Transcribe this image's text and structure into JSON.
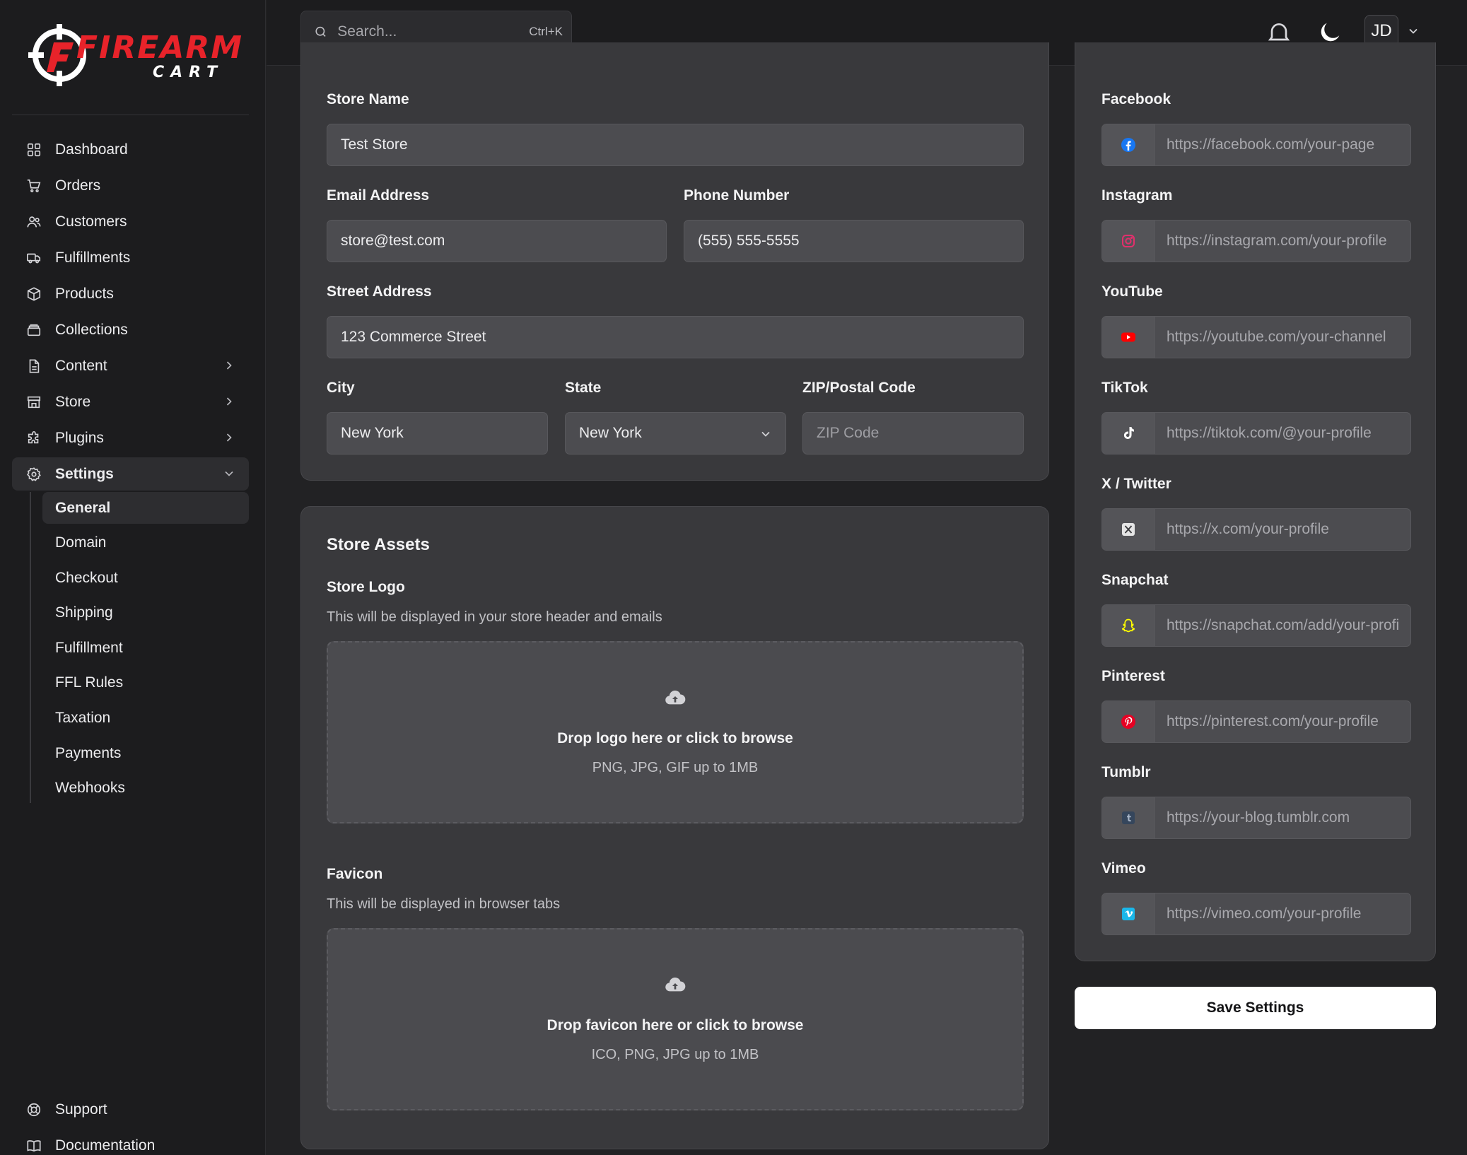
{
  "brand": {
    "name_top": "FIREARM",
    "name_bottom": "CART",
    "accent": "#e8232a"
  },
  "sidebar": {
    "items": [
      {
        "label": "Dashboard",
        "icon": "dashboard-icon"
      },
      {
        "label": "Orders",
        "icon": "cart-icon"
      },
      {
        "label": "Customers",
        "icon": "users-icon"
      },
      {
        "label": "Fulfillments",
        "icon": "truck-icon"
      },
      {
        "label": "Products",
        "icon": "box-icon"
      },
      {
        "label": "Collections",
        "icon": "archive-icon"
      },
      {
        "label": "Content",
        "icon": "document-icon"
      },
      {
        "label": "Store",
        "icon": "store-icon"
      },
      {
        "label": "Plugins",
        "icon": "puzzle-icon"
      },
      {
        "label": "Settings",
        "icon": "gear-icon"
      }
    ],
    "settings_sub": [
      "General",
      "Domain",
      "Checkout",
      "Shipping",
      "Fulfillment",
      "FFL Rules",
      "Taxation",
      "Payments",
      "Webhooks"
    ],
    "active_sub": "General",
    "bottom": [
      {
        "label": "Support",
        "icon": "lifebuoy-icon"
      },
      {
        "label": "Documentation",
        "icon": "book-icon"
      }
    ]
  },
  "topbar": {
    "search_placeholder": "Search...",
    "search_shortcut": "Ctrl+K",
    "avatar_initials": "JD"
  },
  "store_info": {
    "store_name_label": "Store Name",
    "store_name": "Test Store",
    "email_label": "Email Address",
    "email": "store@test.com",
    "phone_label": "Phone Number",
    "phone": "(555) 555-5555",
    "street_label": "Street Address",
    "street": "123 Commerce Street",
    "city_label": "City",
    "city": "New York",
    "state_label": "State",
    "state": "New York",
    "zip_label": "ZIP/Postal Code",
    "zip_placeholder": "ZIP Code"
  },
  "assets": {
    "title": "Store Assets",
    "logo_label": "Store Logo",
    "logo_desc": "This will be displayed in your store header and emails",
    "logo_drop": "Drop logo here or click to browse",
    "logo_types": "PNG, JPG, GIF up to 1MB",
    "favicon_label": "Favicon",
    "favicon_desc": "This will be displayed in browser tabs",
    "favicon_drop": "Drop favicon here or click to browse",
    "favicon_types": "ICO, PNG, JPG up to 1MB"
  },
  "social": [
    {
      "label": "Facebook",
      "placeholder": "https://facebook.com/your-page",
      "icon": "facebook-icon",
      "color": "#1877f2"
    },
    {
      "label": "Instagram",
      "placeholder": "https://instagram.com/your-profile",
      "icon": "instagram-icon",
      "color": "#e1306c"
    },
    {
      "label": "YouTube",
      "placeholder": "https://youtube.com/your-channel",
      "icon": "youtube-icon",
      "color": "#ff0000"
    },
    {
      "label": "TikTok",
      "placeholder": "https://tiktok.com/@your-profile",
      "icon": "tiktok-icon",
      "color": "#ffffff"
    },
    {
      "label": "X / Twitter",
      "placeholder": "https://x.com/your-profile",
      "icon": "x-icon",
      "color": "#e5e5e5"
    },
    {
      "label": "Snapchat",
      "placeholder": "https://snapchat.com/add/your-profile",
      "icon": "snapchat-icon",
      "color": "#fffc00"
    },
    {
      "label": "Pinterest",
      "placeholder": "https://pinterest.com/your-profile",
      "icon": "pinterest-icon",
      "color": "#e60023"
    },
    {
      "label": "Tumblr",
      "placeholder": "https://your-blog.tumblr.com",
      "icon": "tumblr-icon",
      "color": "#35465c"
    },
    {
      "label": "Vimeo",
      "placeholder": "https://vimeo.com/your-profile",
      "icon": "vimeo-icon",
      "color": "#1ab7ea"
    }
  ],
  "save_label": "Save Settings"
}
